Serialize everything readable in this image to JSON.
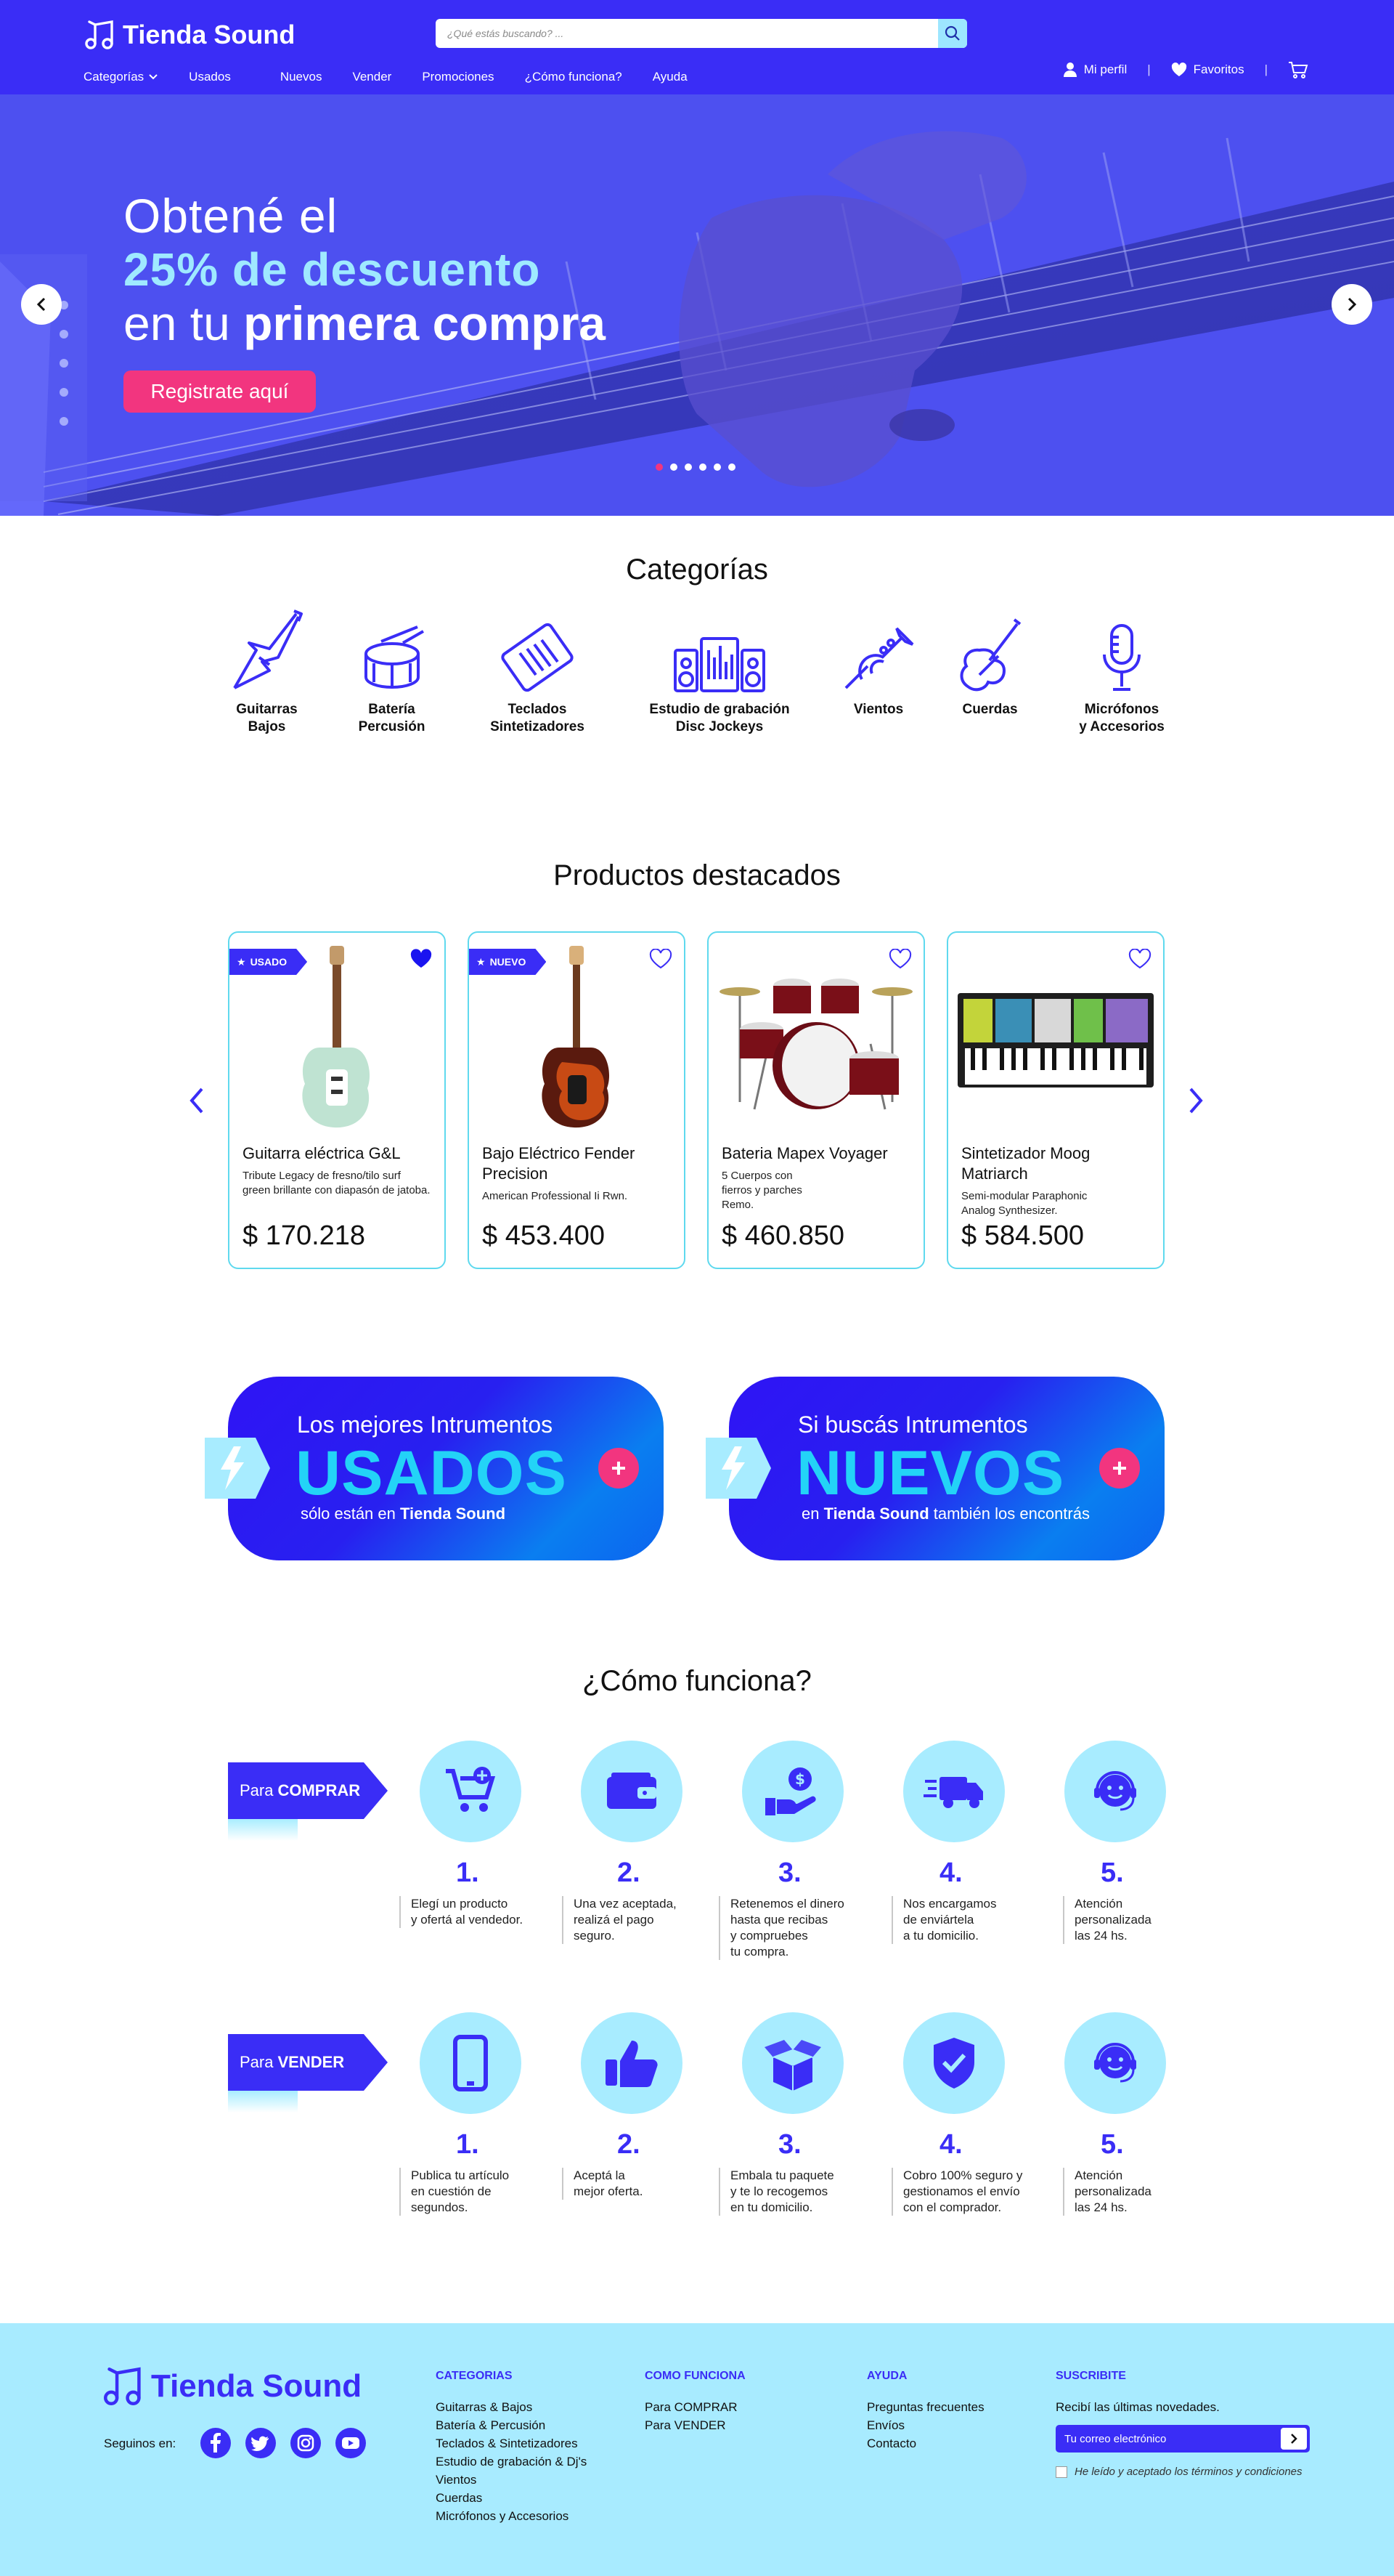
{
  "header": {
    "logo_text": "Tienda Sound",
    "search_placeholder": "¿Qué estás buscando? ...",
    "nav": [
      "Categorías",
      "Usados",
      "Nuevos",
      "Vender",
      "Promociones",
      "¿Cómo funciona?",
      "Ayuda"
    ],
    "profile_label": "Mi perfil",
    "favorites_label": "Favoritos",
    "separator": "|"
  },
  "hero": {
    "line1": "Obtené el",
    "line2": "25% de descuento",
    "line3_prefix": "en tu ",
    "line3_bold": "primera compra",
    "cta": "Registrate aquí",
    "slides": 6,
    "active_slide": 1
  },
  "categories": {
    "title": "Categorías",
    "items": [
      {
        "line1": "Guitarras",
        "line2": "Bajos"
      },
      {
        "line1": "Batería",
        "line2": "Percusión"
      },
      {
        "line1": "Teclados",
        "line2": "Sintetizadores"
      },
      {
        "line1": "Estudio de grabación",
        "line2": "Disc Jockeys"
      },
      {
        "line1": "Vientos",
        "line2": ""
      },
      {
        "line1": "Cuerdas",
        "line2": ""
      },
      {
        "line1": "Micrófonos",
        "line2": "y Accesorios"
      }
    ]
  },
  "featured": {
    "title": "Productos destacados",
    "products": [
      {
        "badge": "USADO",
        "favorite": true,
        "name": "Guitarra eléctrica G&L",
        "description": "Tribute Legacy de fresno/tilo surf green brillante con diapasón de jatoba.",
        "price": "$ 170.218"
      },
      {
        "badge": "NUEVO",
        "favorite": false,
        "name": "Bajo Eléctrico Fender Precision",
        "description": "American Professional Ii Rwn.",
        "price": "$ 453.400"
      },
      {
        "badge": "",
        "favorite": false,
        "name": "Bateria Mapex Voyager",
        "description": "5 Cuerpos con fierros y parches Remo.",
        "price": "$ 460.850"
      },
      {
        "badge": "",
        "favorite": false,
        "name": "Sintetizador Moog Matriarch",
        "description": "Semi-modular Paraphonic Analog Synthesizer.",
        "price": "$ 584.500"
      }
    ]
  },
  "promos": [
    {
      "line1": "Los mejores Intrumentos",
      "big": "USADOS",
      "line3_pre": "sólo están en ",
      "line3_bold": "Tienda Sound",
      "line3_post": ""
    },
    {
      "line1": "Si buscás Intrumentos",
      "big": "NUEVOS",
      "line3_pre": "en ",
      "line3_bold": "Tienda Sound",
      "line3_post": " también los encontrás"
    }
  ],
  "how": {
    "title": "¿Cómo funciona?",
    "buy": {
      "tag_pre": "Para",
      "tag_bold": "COMPRAR",
      "steps": [
        {
          "n": "1.",
          "text": "Elegí un producto\ny ofertá al vendedor."
        },
        {
          "n": "2.",
          "text": "Una vez aceptada,\nrealizá el pago\nseguro."
        },
        {
          "n": "3.",
          "text": "Retenemos el dinero\nhasta que recibas\ny compruebes\ntu compra."
        },
        {
          "n": "4.",
          "text": "Nos encargamos\nde enviártela\na tu domicilio."
        },
        {
          "n": "5.",
          "text": "Atención\npersonalizada\nlas 24 hs."
        }
      ]
    },
    "sell": {
      "tag_pre": "Para",
      "tag_bold": "VENDER",
      "steps": [
        {
          "n": "1.",
          "text": "Publica tu artículo\nen cuestión de\nsegundos."
        },
        {
          "n": "2.",
          "text": "Aceptá la\nmejor oferta."
        },
        {
          "n": "3.",
          "text": "Embala tu paquete\ny te lo recogemos\nen tu domicilio."
        },
        {
          "n": "4.",
          "text": "Cobro 100% seguro y\ngestionamos el envío\ncon el comprador."
        },
        {
          "n": "5.",
          "text": "Atención\npersonalizada\nlas 24 hs."
        }
      ]
    }
  },
  "footer": {
    "logo_text": "Tienda Sound",
    "follow": "Seguinos en:",
    "categorias": {
      "title": "CATEGORIAS",
      "links": [
        "Guitarras & Bajos",
        "Batería  & Percusión",
        "Teclados & Sintetizadores",
        "Estudio de grabación & Dj's",
        "Vientos",
        "Cuerdas",
        "Micrófonos y Accesorios"
      ]
    },
    "como": {
      "title": "COMO FUNCIONA",
      "links": [
        "Para COMPRAR",
        "Para VENDER"
      ]
    },
    "ayuda": {
      "title": "AYUDA",
      "links": [
        "Preguntas frecuentes",
        "Envíos",
        "Contacto"
      ]
    },
    "suscribite": {
      "title": "SUSCRIBITE",
      "text": "Recibí las últimas novedades.",
      "placeholder": "Tu correo electrónico",
      "terms": "He leído y aceptado los términos y condiciones"
    }
  },
  "colors": {
    "primary": "#3a2df6",
    "accent": "#f2357f",
    "light": "#a8ebff",
    "cyan": "#23d3f7"
  }
}
